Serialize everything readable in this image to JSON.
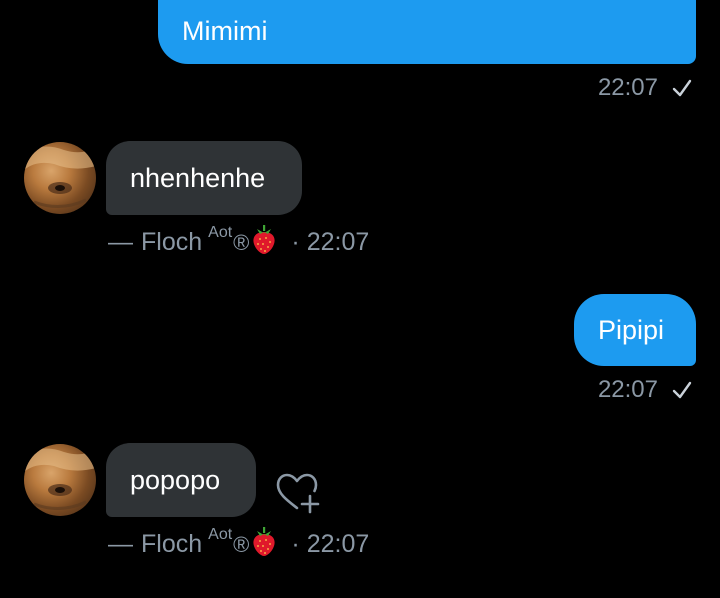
{
  "messages": [
    {
      "direction": "out",
      "text": "Mimimi",
      "time": "22:07"
    },
    {
      "direction": "in",
      "text": "nhenhenhe",
      "sender": "Floch",
      "sender_sup": "Aot",
      "sender_reg": "®",
      "time": "22:07"
    },
    {
      "direction": "out",
      "text": "Pipipi",
      "time": "22:07"
    },
    {
      "direction": "in",
      "text": "popopo",
      "sender": "Floch",
      "sender_sup": "Aot",
      "sender_reg": "®",
      "time": "22:07"
    }
  ],
  "meta": {
    "dash": "—",
    "separator": "·"
  },
  "icons": {
    "read_receipt": "checkmark-icon",
    "reaction": "heart-add-icon",
    "emoji": "strawberry-icon"
  },
  "colors": {
    "background": "#000000",
    "outgoing_bubble": "#1d9bf0",
    "incoming_bubble": "#2f3336",
    "meta_text": "#8b98a5"
  }
}
